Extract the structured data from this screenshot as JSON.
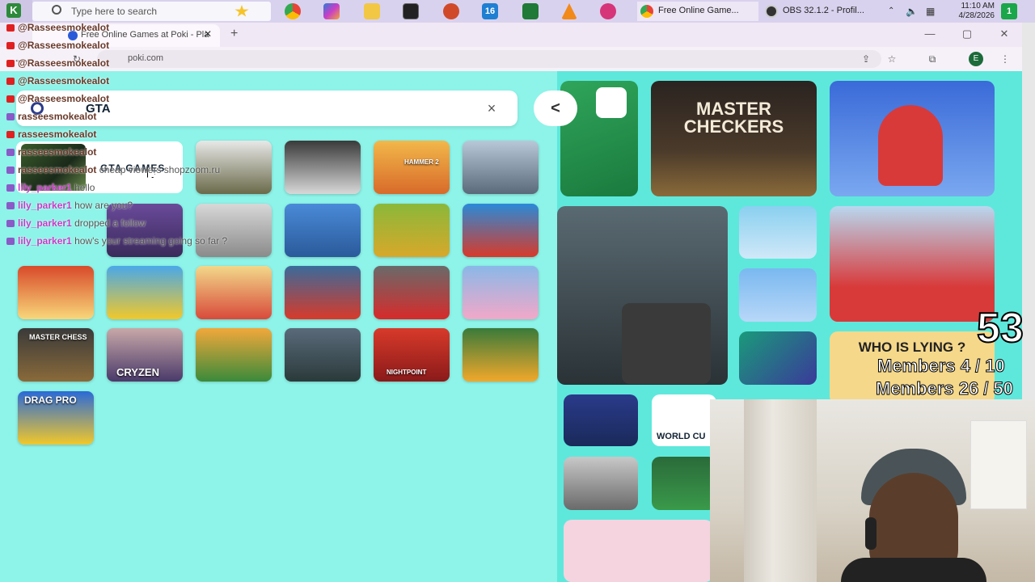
{
  "taskbar": {
    "search_placeholder": "Type here to search",
    "start_label": "K",
    "windows": [
      {
        "label": "Free Online Game...",
        "icon": "chrome-icon"
      },
      {
        "label": "OBS 32.1.2 - Profil...",
        "icon": "obs-icon"
      }
    ],
    "clock_time": "11:10 AM",
    "clock_date": "4/28/2026",
    "notification_count": "1",
    "badge_16": "16"
  },
  "browser": {
    "tab_title": "Free Online Games at Poki - Pla",
    "new_tab": "+",
    "url": "poki.com",
    "profile_initial": "E"
  },
  "search": {
    "query": "GTA",
    "suggestion": "GTA GAMES",
    "clear": "×",
    "collapse": "<"
  },
  "right_panel": {
    "checkers_title": "MASTER CHECKERS",
    "lying_title": "WHO IS LYING ?",
    "world_cup_label": "WORLD CU"
  },
  "results_tiles": {
    "chess_label": "MASTER CHESS",
    "cryzen_label": "CRYZEN",
    "drag_label": "DRAG PRO",
    "night_label": "NIGHTPOINT",
    "hammer_label": "HAMMER 2"
  },
  "overlay": {
    "counter": "53",
    "members_a": "Members 4 / 10",
    "members_b": "Members 26 / 50"
  },
  "chat": [
    {
      "platform": "youtube",
      "user": "@Rasseesmokealot",
      "msg": ""
    },
    {
      "platform": "youtube",
      "user": "@Rasseesmokealot",
      "msg": ""
    },
    {
      "platform": "youtube",
      "user": "@Rasseesmokealot",
      "msg": ""
    },
    {
      "platform": "youtube",
      "user": "@Rasseesmokealot",
      "msg": ""
    },
    {
      "platform": "youtube",
      "user": "@Rasseesmokealot",
      "msg": ""
    },
    {
      "platform": "twitch",
      "user": "rasseesmokealot",
      "msg": ""
    },
    {
      "platform": "youtube",
      "user": "rasseesmokealot",
      "msg": ""
    },
    {
      "platform": "twitch",
      "user": "rasseesmokealot",
      "msg": ""
    },
    {
      "platform": "twitch",
      "user": "rasseesmokealot",
      "msg": "cheap viewers shopzoom.ru"
    },
    {
      "platform": "twitch",
      "user": "lily_parker1",
      "msg": "hello"
    },
    {
      "platform": "twitch",
      "user": "lily_parker1",
      "msg": "how are you?"
    },
    {
      "platform": "twitch",
      "user": "lily_parker1",
      "msg": "dropped a follow"
    },
    {
      "platform": "twitch",
      "user": "lily_parker1",
      "msg": "how's your streaming going so far ?"
    }
  ],
  "colors": {
    "page_bg": "#5ee8dc",
    "left_panel_bg": "#8ef3e8",
    "youtube_red": "#e02020",
    "twitch_purple": "#8a5ac8"
  }
}
